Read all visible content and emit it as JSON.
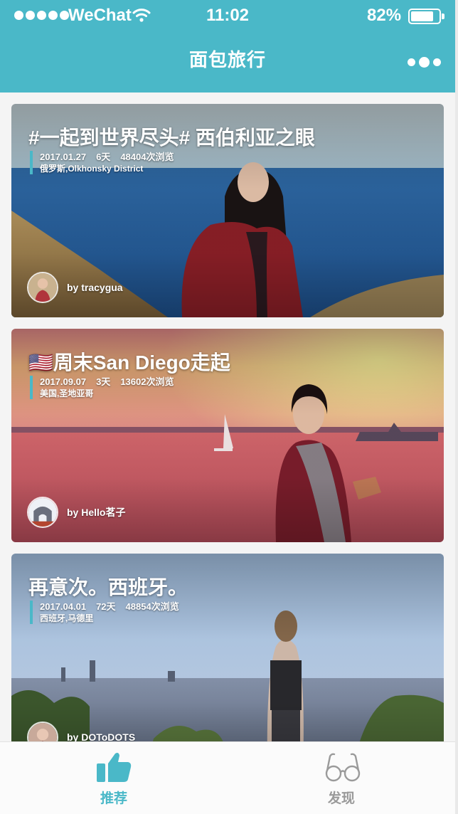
{
  "status_bar": {
    "carrier": "WeChat",
    "time": "11:02",
    "battery": "82%",
    "battery_level": 0.82
  },
  "nav": {
    "title": "面包旅行",
    "more_icon": "more-dots-icon"
  },
  "colors": {
    "accent": "#4ab8c8",
    "tab_inactive": "#9a9a9a"
  },
  "trips": [
    {
      "title": "#一起到世界尽头# 西伯利亚之眼",
      "date": "2017.01.27",
      "days": "6天",
      "views": "48404次浏览",
      "location": "俄罗斯,Olkhonsky District",
      "author": "by tracygua"
    },
    {
      "title": "🇺🇸周末San Diego走起",
      "date": "2017.09.07",
      "days": "3天",
      "views": "13602次浏览",
      "location": "美国,圣地亚哥",
      "author": "by Hello茗子"
    },
    {
      "title": "再意次。西班牙。",
      "date": "2017.04.01",
      "days": "72天",
      "views": "48854次浏览",
      "location": "西班牙,马德里",
      "author": "by DOToDOTS"
    }
  ],
  "tabs": [
    {
      "label": "推荐",
      "icon": "thumbs-up-icon",
      "active": true
    },
    {
      "label": "发现",
      "icon": "glasses-icon",
      "active": false
    }
  ]
}
